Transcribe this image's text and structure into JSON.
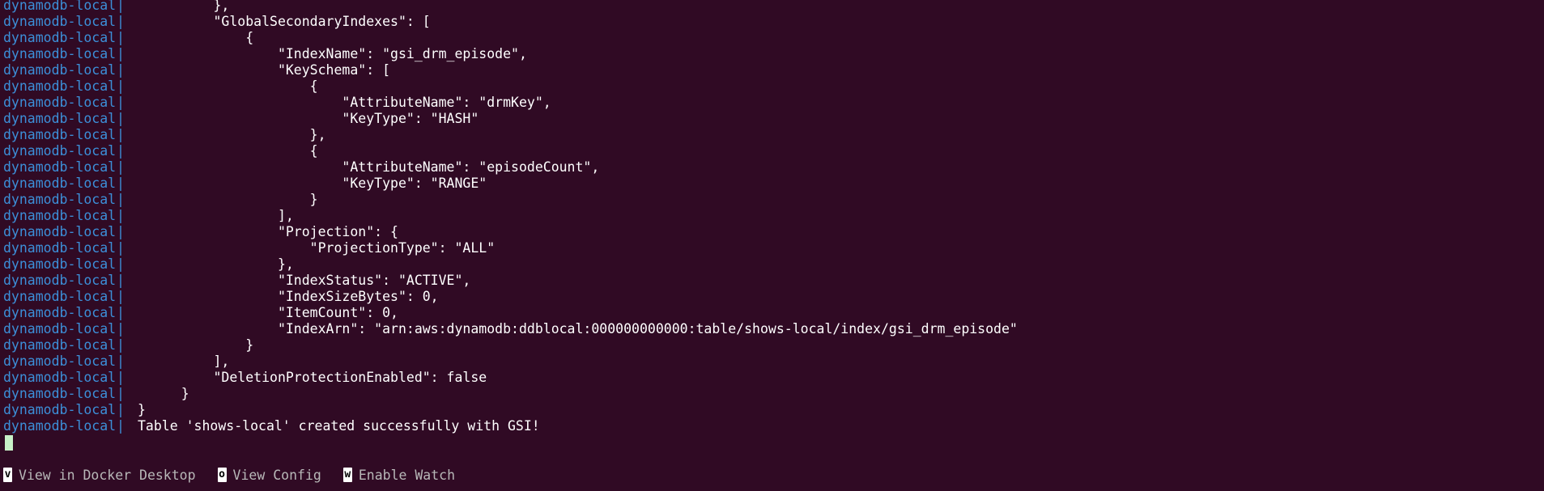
{
  "service_name": "dynamodb-local",
  "separator": "|",
  "log_lines": [
    "        },",
    "        \"GlobalSecondaryIndexes\": [",
    "            {",
    "                \"IndexName\": \"gsi_drm_episode\",",
    "                \"KeySchema\": [",
    "                    {",
    "                        \"AttributeName\": \"drmKey\",",
    "                        \"KeyType\": \"HASH\"",
    "                    },",
    "                    {",
    "                        \"AttributeName\": \"episodeCount\",",
    "                        \"KeyType\": \"RANGE\"",
    "                    }",
    "                ],",
    "                \"Projection\": {",
    "                    \"ProjectionType\": \"ALL\"",
    "                },",
    "                \"IndexStatus\": \"ACTIVE\",",
    "                \"IndexSizeBytes\": 0,",
    "                \"ItemCount\": 0,",
    "                \"IndexArn\": \"arn:aws:dynamodb:ddblocal:000000000000:table/shows-local/index/gsi_drm_episode\"",
    "            }",
    "        ],",
    "        \"DeletionProtectionEnabled\": false",
    "    }",
    "}",
    "Table 'shows-local' created successfully with GSI!"
  ],
  "footer": {
    "items": [
      {
        "key": "v",
        "label": "View in Docker Desktop"
      },
      {
        "key": "o",
        "label": "View Config"
      },
      {
        "key": "w",
        "label": "Enable Watch"
      }
    ]
  }
}
